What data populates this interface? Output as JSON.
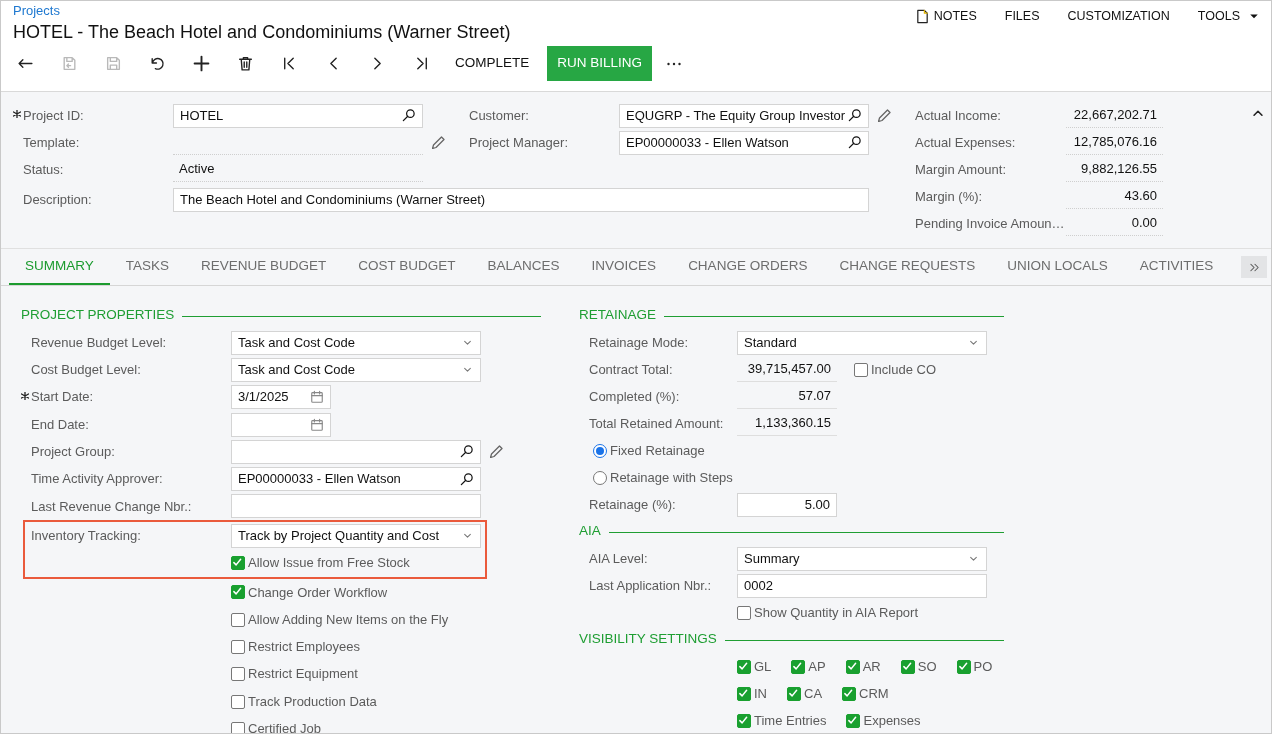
{
  "breadcrumb": "Projects",
  "title": "HOTEL - The Beach Hotel and Condominiums (Warner Street)",
  "top_links": [
    {
      "label": "NOTES",
      "kind": "notes"
    },
    {
      "label": "FILES",
      "kind": "plain"
    },
    {
      "label": "CUSTOMIZATION",
      "kind": "plain"
    },
    {
      "label": "TOOLS",
      "kind": "menu"
    }
  ],
  "toolbar": [
    {
      "kind": "back",
      "disabled": false
    },
    {
      "kind": "save-close",
      "disabled": true
    },
    {
      "kind": "save",
      "disabled": true
    },
    {
      "kind": "undo",
      "disabled": false
    },
    {
      "kind": "add",
      "disabled": false
    },
    {
      "kind": "delete",
      "disabled": false
    },
    {
      "kind": "first",
      "disabled": false
    },
    {
      "kind": "prev",
      "disabled": false
    },
    {
      "kind": "next",
      "disabled": false
    },
    {
      "kind": "last",
      "disabled": false
    },
    {
      "kind": "text",
      "label": "COMPLETE",
      "disabled": false
    },
    {
      "kind": "primary",
      "label": "RUN BILLING",
      "disabled": false
    },
    {
      "kind": "more",
      "disabled": false
    }
  ],
  "summary": {
    "rows": [
      {
        "fields": [
          {
            "label": "Project ID:",
            "kind": "lookup",
            "value": "HOTEL",
            "required": true
          },
          {
            "label": "Customer:",
            "kind": "lookup",
            "value": "EQUGRP - The Equity Group Investor",
            "editable": true
          }
        ]
      },
      {
        "fields": [
          {
            "label": "Template:",
            "kind": "readonly",
            "editable": true
          },
          {
            "label": "Project Manager:",
            "kind": "lookup",
            "value": "EP00000033 - Ellen Watson"
          }
        ]
      },
      {
        "fields": [
          {
            "label": "Status:",
            "kind": "readonly",
            "value": "Active"
          }
        ]
      },
      {
        "fields": [
          {
            "label": "Description:",
            "kind": "text",
            "value": "The Beach Hotel and Condominiums (Warner Street)"
          }
        ]
      }
    ],
    "totals": [
      {
        "label": "Actual Income:",
        "value": "22,667,202.71"
      },
      {
        "label": "Actual Expenses:",
        "value": "12,785,076.16"
      },
      {
        "label": "Margin Amount:",
        "value": "9,882,126.55"
      },
      {
        "label": "Margin (%):",
        "value": "43.60"
      },
      {
        "label": "Pending Invoice Amoun…",
        "value": "0.00"
      }
    ]
  },
  "tabs": [
    {
      "label": "SUMMARY",
      "selected": true
    },
    {
      "label": "TASKS",
      "selected": false
    },
    {
      "label": "REVENUE BUDGET",
      "selected": false
    },
    {
      "label": "COST BUDGET",
      "selected": false
    },
    {
      "label": "BALANCES",
      "selected": false
    },
    {
      "label": "INVOICES",
      "selected": false
    },
    {
      "label": "CHANGE ORDERS",
      "selected": false
    },
    {
      "label": "CHANGE REQUESTS",
      "selected": false
    },
    {
      "label": "UNION LOCALS",
      "selected": false
    },
    {
      "label": "ACTIVITIES",
      "selected": false
    }
  ],
  "project_properties": {
    "title": "PROJECT PROPERTIES",
    "rows": [
      {
        "kind": "select",
        "label": "Revenue Budget Level:",
        "value": "Task and Cost Code",
        "highlighted": false
      },
      {
        "kind": "select",
        "label": "Cost Budget Level:",
        "value": "Task and Cost Code",
        "highlighted": false
      },
      {
        "kind": "date",
        "label": "Start Date:",
        "value": "3/1/2025",
        "required": true,
        "highlighted": false
      },
      {
        "kind": "date",
        "label": "End Date:",
        "highlighted": false
      },
      {
        "kind": "lookup",
        "label": "Project Group:",
        "editable": true,
        "highlighted": false
      },
      {
        "kind": "lookup",
        "label": "Time Activity Approver:",
        "value": "EP00000033 - Ellen Watson",
        "highlighted": false
      },
      {
        "kind": "text",
        "label": "Last Revenue Change Nbr.:",
        "highlighted": false
      },
      {
        "kind": "select",
        "label": "Inventory Tracking:",
        "value": "Track by Project Quantity and Cost",
        "highlighted": true
      },
      {
        "kind": "checkbox",
        "label": "Allow Issue from Free Stock",
        "checked": true,
        "highlighted": true
      },
      {
        "kind": "checkbox",
        "label": "Change Order Workflow",
        "checked": true,
        "highlighted": false
      },
      {
        "kind": "checkbox",
        "label": "Allow Adding New Items on the Fly",
        "checked": false,
        "highlighted": false
      },
      {
        "kind": "checkbox",
        "label": "Restrict Employees",
        "checked": false,
        "highlighted": false
      },
      {
        "kind": "checkbox",
        "label": "Restrict Equipment",
        "checked": false,
        "highlighted": false
      },
      {
        "kind": "checkbox",
        "label": "Track Production Data",
        "checked": false,
        "highlighted": false
      },
      {
        "kind": "checkbox",
        "label": "Certified Job",
        "checked": false,
        "highlighted": false
      }
    ]
  },
  "right_sections": [
    {
      "title": "RETAINAGE",
      "rows": [
        {
          "kind": "select",
          "label": "Retainage Mode:",
          "value": "Standard"
        },
        {
          "kind": "amount",
          "label": "Contract Total:",
          "value": "39,715,457.00",
          "addon": {
            "label": "Include CO",
            "checked": false
          }
        },
        {
          "kind": "amount",
          "label": "Completed (%):",
          "value": "57.07"
        },
        {
          "kind": "amount",
          "label": "Total Retained Amount:",
          "value": "1,133,360.15"
        },
        {
          "kind": "radio",
          "label": "Fixed Retainage",
          "selected": true
        },
        {
          "kind": "radio",
          "label": "Retainage with Steps",
          "selected": false
        },
        {
          "kind": "number",
          "label": "Retainage (%):",
          "value": "5.00"
        }
      ]
    },
    {
      "title": "AIA",
      "rows": [
        {
          "kind": "select",
          "label": "AIA Level:",
          "value": "Summary"
        },
        {
          "kind": "text",
          "label": "Last Application Nbr.:",
          "value": "0002"
        },
        {
          "kind": "checkbox",
          "label": "Show Quantity in AIA Report",
          "checked": false
        }
      ]
    },
    {
      "title": "VISIBILITY SETTINGS",
      "rows": [
        {
          "kind": "checkgroup",
          "items": [
            {
              "label": "GL",
              "checked": true
            },
            {
              "label": "AP",
              "checked": true
            },
            {
              "label": "AR",
              "checked": true
            },
            {
              "label": "SO",
              "checked": true
            },
            {
              "label": "PO",
              "checked": true
            }
          ]
        },
        {
          "kind": "checkgroup",
          "items": [
            {
              "label": "IN",
              "checked": true
            },
            {
              "label": "CA",
              "checked": true
            },
            {
              "label": "CRM",
              "checked": true
            }
          ]
        },
        {
          "kind": "checkgroup",
          "items": [
            {
              "label": "Time Entries",
              "checked": true
            },
            {
              "label": "Expenses",
              "checked": true
            }
          ]
        }
      ]
    }
  ]
}
